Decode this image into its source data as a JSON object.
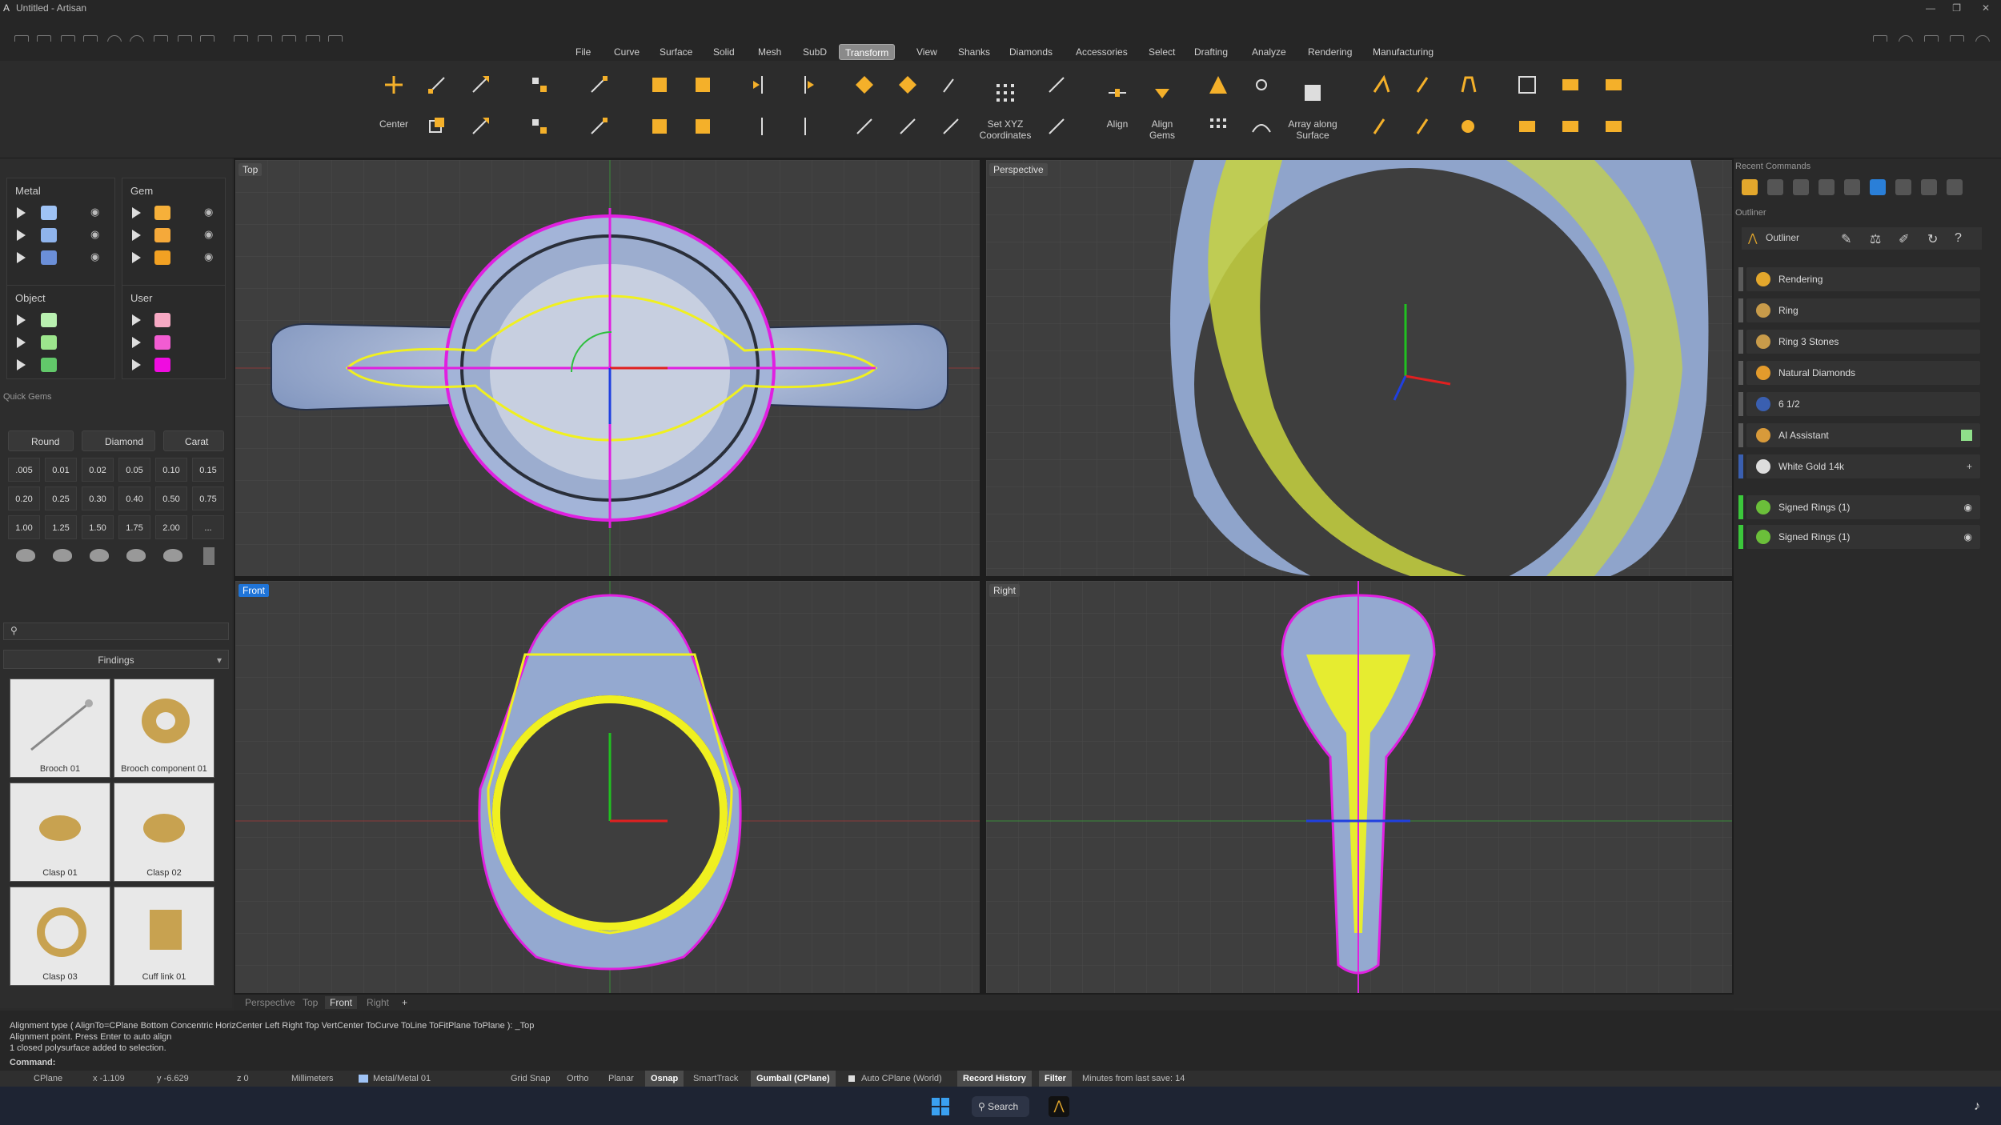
{
  "window": {
    "title": "Untitled - Artisan"
  },
  "menu": [
    "File",
    "Curve",
    "Surface",
    "Solid",
    "Mesh",
    "SubD",
    "Transform",
    "View",
    "Shanks",
    "Diamonds",
    "Accessories",
    "Select",
    "Drafting",
    "Analyze",
    "Rendering",
    "Manufacturing"
  ],
  "active_menu": "Transform",
  "ribbon": {
    "center_label": "Center",
    "set_xyz_label": "Set XYZ Coordinates",
    "align_label": "Align",
    "align_gems_label": "Align Gems",
    "array_surface_label": "Array along Surface"
  },
  "layers": {
    "metal": {
      "title": "Metal",
      "colors": [
        "#9fc3f5",
        "#8fb4ec",
        "#6b8fd8"
      ]
    },
    "gem": {
      "title": "Gem",
      "colors": [
        "#f6b03a",
        "#f5a93a",
        "#f2a123"
      ]
    },
    "object": {
      "title": "Object",
      "colors": [
        "#b9f0b0",
        "#9de68d",
        "#62c86a"
      ]
    },
    "user": {
      "title": "User",
      "colors": [
        "#f7a9c4",
        "#f25cd2",
        "#f00ce0"
      ]
    }
  },
  "quick_gems": {
    "title": "Quick Gems",
    "shape": "Round",
    "material": "Diamond",
    "unit": "Carat",
    "sizes": [
      ".005",
      "0.01",
      "0.02",
      "0.05",
      "0.10",
      "0.15",
      "0.20",
      "0.25",
      "0.30",
      "0.40",
      "0.50",
      "0.75",
      "1.00",
      "1.25",
      "1.50",
      "1.75",
      "2.00",
      "..."
    ]
  },
  "library": {
    "category": "Findings",
    "items": [
      "Brooch 01",
      "Brooch component 01",
      "Clasp 01",
      "Clasp 02",
      "Clasp 03",
      "Cuff link 01"
    ]
  },
  "viewports": {
    "top": "Top",
    "perspective": "Perspective",
    "front": "Front",
    "right": "Right"
  },
  "viewport_tabs": [
    "Perspective",
    "Top",
    "Front",
    "Right"
  ],
  "active_viewport_tab": "Front",
  "right_panel": {
    "recent_title": "Recent Commands",
    "outliner_section": "Outliner",
    "outliner_header": "Outliner",
    "items": [
      "Rendering",
      "Ring",
      "Ring 3 Stones",
      "Natural Diamonds",
      "6 1/2",
      "AI Assistant",
      "White Gold 14k",
      "Signed Rings (1)",
      "Signed Rings (1)"
    ]
  },
  "command_history": [
    "Alignment type ( AlignTo=CPlane  Bottom  Concentric  HorizCenter  Left  Right  Top  VertCenter  ToCurve  ToLine  ToFitPlane  ToPlane ): _Top",
    "Alignment point. Press Enter to auto align",
    "1 closed polysurface added to selection."
  ],
  "command_prompt": "Command:",
  "status": {
    "cplane": "CPlane",
    "x": "x -1.109",
    "y": "y -6.629",
    "z": "z 0",
    "units": "Millimeters",
    "layer": "Metal/Metal 01",
    "grid_snap": "Grid Snap",
    "ortho": "Ortho",
    "planar": "Planar",
    "osnap": "Osnap",
    "smarttrack": "SmartTrack",
    "gumball": "Gumball (CPlane)",
    "auto_cplane": "Auto CPlane (World)",
    "record_history": "Record History",
    "filter": "Filter",
    "save_info": "Minutes from last save: 14"
  },
  "taskbar": {
    "search": "Search"
  },
  "colors": {
    "accent": "#1f74d8",
    "curve_magenta": "#e020e0",
    "wire_yellow": "#f0f020",
    "metal_blue": "#93a8cf"
  }
}
